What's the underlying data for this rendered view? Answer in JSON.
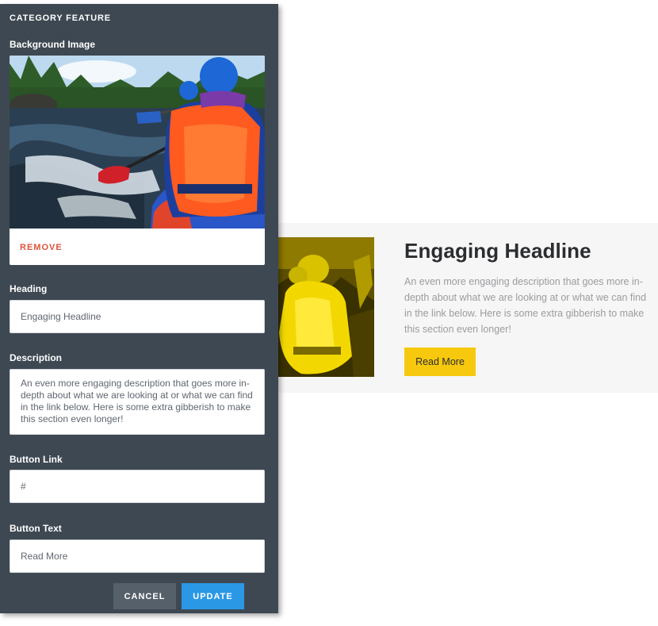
{
  "panel": {
    "title": "CATEGORY FEATURE",
    "background_image": {
      "label": "Background Image",
      "remove_label": "REMOVE"
    },
    "heading": {
      "label": "Heading",
      "value": "Engaging Headline"
    },
    "description": {
      "label": "Description",
      "value": "An even more engaging description that goes more in-depth about what we are looking at or what we can find in the link below. Here is some extra gibberish to make this section even longer!"
    },
    "button_link": {
      "label": "Button Link",
      "value": "#"
    },
    "button_text": {
      "label": "Button Text",
      "value": "Read More"
    },
    "actions": {
      "cancel_label": "CANCEL",
      "update_label": "UPDATE"
    }
  },
  "preview": {
    "headline": "Engaging Headline",
    "description": "An even more engaging description that goes more in-depth about what we are looking at or what we can find in the link below. Here is some extra gibberish to make this section even longer!",
    "button_label": "Read More"
  },
  "colors": {
    "panel_bg": "#3e4852",
    "accent_blue": "#2b98e6",
    "accent_yellow": "#f6c90e",
    "remove_red": "#e0523b",
    "cancel_bg": "#56606a"
  }
}
